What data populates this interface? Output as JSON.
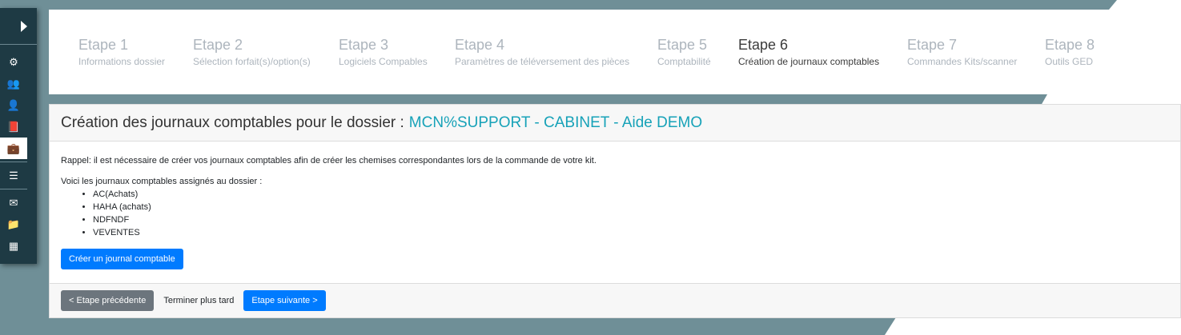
{
  "sidebar": {
    "items": [
      {
        "icon": "gear-icon",
        "glyph": "⚙"
      },
      {
        "icon": "users-icon",
        "glyph": "👥"
      },
      {
        "icon": "user-icon",
        "glyph": "👤"
      },
      {
        "icon": "book-icon",
        "glyph": "📕"
      },
      {
        "icon": "briefcase-icon",
        "glyph": "💼",
        "active": true
      },
      {
        "icon": "list-icon",
        "glyph": "☰"
      },
      {
        "icon": "envelope-icon",
        "glyph": "✉"
      },
      {
        "icon": "folder-icon",
        "glyph": "📁"
      },
      {
        "icon": "table-icon",
        "glyph": "▦"
      }
    ]
  },
  "steps": [
    {
      "num": "Etape 1",
      "desc": "Informations dossier"
    },
    {
      "num": "Etape 2",
      "desc": "Sélection forfait(s)/option(s)"
    },
    {
      "num": "Etape 3",
      "desc": "Logiciels Compables"
    },
    {
      "num": "Etape 4",
      "desc": "Paramètres de téléversement des pièces"
    },
    {
      "num": "Etape 5",
      "desc": "Comptabilité"
    },
    {
      "num": "Etape 6",
      "desc": "Création de journaux comptables",
      "active": true
    },
    {
      "num": "Etape 7",
      "desc": "Commandes Kits/scanner"
    },
    {
      "num": "Etape 8",
      "desc": "Outils GED"
    }
  ],
  "card": {
    "title": "Création des journaux comptables pour le dossier :",
    "dossier": "MCN%SUPPORT - CABINET - Aide DEMO",
    "reminder": "Rappel: il est nécessaire de créer vos journaux comptables afin de créer les chemises correspondantes lors de la commande de votre kit.",
    "intro": "Voici les journaux comptables assignés au dossier :",
    "journals": [
      "AC(Achats)",
      "HAHA (achats)",
      "NDFNDF",
      "VEVENTES"
    ],
    "create_label": "Créer un journal comptable"
  },
  "footer": {
    "prev_label": "< Etape précédente",
    "later_label": "Terminer plus tard",
    "next_label": "Etape suivante >"
  },
  "colors": {
    "background": "#6f8f97",
    "sidebar": "#1e3a44",
    "primary": "#007bff",
    "secondary": "#6c757d",
    "dossier": "#17a2b8"
  }
}
